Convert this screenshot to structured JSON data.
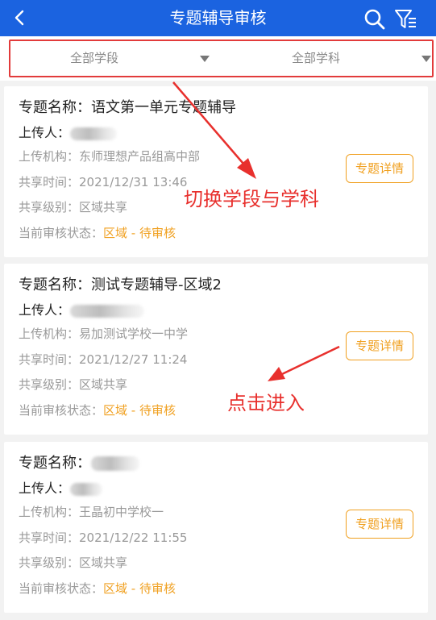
{
  "header": {
    "title": "专题辅导审核",
    "back_icon": "chevron-left-icon",
    "search_icon": "search-icon",
    "filter_icon": "filter-icon",
    "background": "#1b63e0"
  },
  "filters": {
    "stage_label": "全部学段",
    "subject_label": "全部学科"
  },
  "labels": {
    "name": "专题名称：",
    "uploader": "上传人：",
    "org": "上传机构：",
    "time": "共享时间：",
    "level": "共享级别：",
    "status": "当前审核状态：",
    "detail_button": "专题详情"
  },
  "items": [
    {
      "name": "语文第一单元专题辅导",
      "uploader": "",
      "org": "东师理想产品组高中部",
      "time": "2021/12/31 13:46",
      "level": "区域共享",
      "status": "区域 - 待审核"
    },
    {
      "name": "测试专题辅导-区域2",
      "uploader": "",
      "org": "易加测试学校一中学",
      "time": "2021/12/27 11:24",
      "level": "区域共享",
      "status": "区域 - 待审核"
    },
    {
      "name": "",
      "uploader": "",
      "org": "王晶初中学校一",
      "time": "2021/12/22 11:55",
      "level": "区域共享",
      "status": "区域 - 待审核"
    }
  ],
  "annotations": {
    "switch_text": "切换学段与学科",
    "enter_text": "点击进入",
    "color": "#e8302d"
  },
  "colors": {
    "accent_orange": "#f0a020",
    "header_blue": "#1b63e0"
  }
}
